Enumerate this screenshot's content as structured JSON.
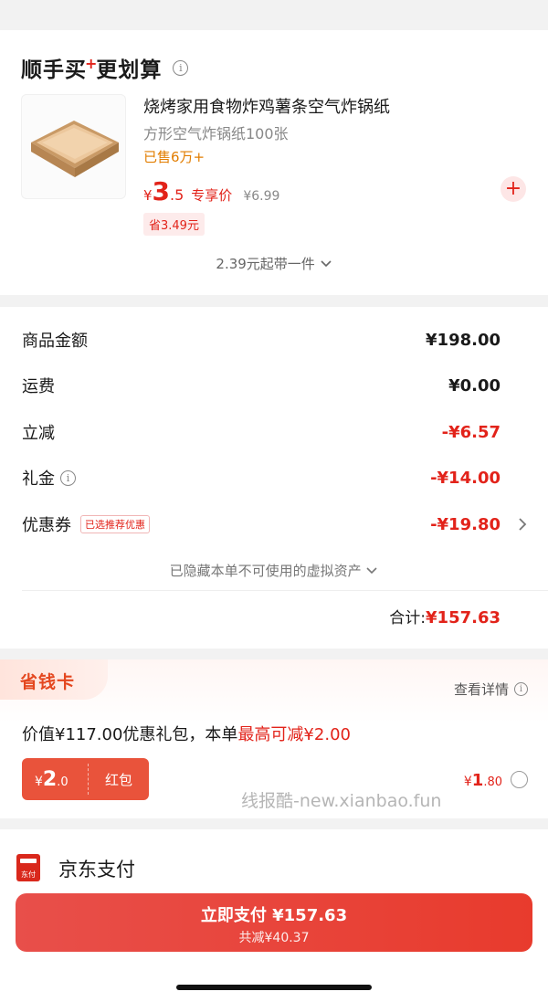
{
  "promo": {
    "title_before": "顺手买",
    "title_mark": "+",
    "title_after": "更划算",
    "product": {
      "name": "烧烤家用食物炸鸡薯条空气炸锅纸",
      "subtitle": "方形空气炸锅纸100张",
      "sold": "已售6万+",
      "price_yen": "¥",
      "price_int": "3",
      "price_dec": ".5",
      "price_label": "专享价",
      "orig_price": "¥6.99",
      "save_tag": "省3.49元"
    },
    "add_symbol": "+",
    "bring_text": "2.39元起带一件"
  },
  "summary": {
    "rows": [
      {
        "label": "商品金额",
        "value": "¥198.00"
      },
      {
        "label": "运费",
        "value": "¥0.00"
      },
      {
        "label": "立减",
        "value": "-¥6.57"
      },
      {
        "label": "礼金",
        "value": "-¥14.00"
      },
      {
        "label": "优惠券",
        "value": "-¥19.80",
        "tag": "已选推荐优惠"
      }
    ],
    "hidden_text": "已隐藏本单不可使用的虚拟资产",
    "total_label": "合计:",
    "total_value": "¥157.63"
  },
  "savings_card": {
    "badge": "省钱卡",
    "detail_link": "查看详情",
    "desc_before": "价值¥117.00优惠礼包，本单",
    "desc_highlight": "最高可减¥2.00",
    "redpack": {
      "yen": "¥",
      "int": "2",
      "dec": ".0",
      "label": "红包"
    },
    "price": {
      "yen": "¥",
      "int": "1",
      "dec": ".80"
    },
    "selected": false
  },
  "watermark": "线报酷-new.xianbao.fun",
  "payment": {
    "method_icon_text": "东付",
    "method": "京东支付",
    "button_main": "立即支付 ¥157.63",
    "button_sub": "共减¥40.37"
  },
  "colors": {
    "accent": "#e2231a",
    "orange": "#e27d00"
  },
  "icons": [
    "info-icon",
    "plus-icon",
    "chevron-down-icon",
    "chevron-right-icon",
    "radio-icon",
    "jd-pay-icon"
  ]
}
